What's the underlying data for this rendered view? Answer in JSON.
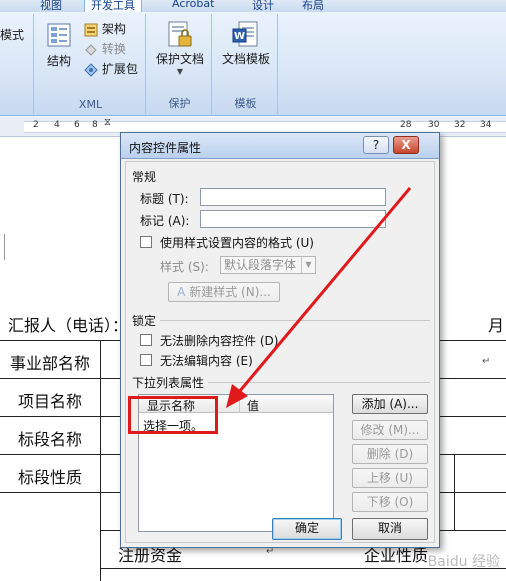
{
  "ribbon": {
    "tabs": [
      "视图",
      "开发工具",
      "Acrobat",
      "设计",
      "布局"
    ],
    "active_tab": "开发工具",
    "mode_label": "模式",
    "xml": {
      "structure": "结构",
      "schema": "架构",
      "transform": "转换",
      "expansion": "扩展包",
      "group": "XML"
    },
    "protect": {
      "protect_doc": "保护文档",
      "group": "保护"
    },
    "template": {
      "doc_template": "文档模板",
      "group": "模板"
    }
  },
  "ruler": [
    "2",
    "4",
    "6",
    "8",
    "28",
    "30",
    "32",
    "34"
  ],
  "document": {
    "reporter": "汇报人（电话）：",
    "month": "月",
    "rows": [
      "事业部名称",
      "项目名称",
      "标段名称",
      "标段性质"
    ],
    "bottom_left": "注册资金",
    "bottom_right": "企业性质"
  },
  "dialog": {
    "title": "内容控件属性",
    "help": "?",
    "close": "X",
    "general": {
      "section": "常规",
      "title_label": "标题 (T):",
      "title_value": "",
      "tag_label": "标记 (A):",
      "tag_value": "",
      "use_style": "使用样式设置内容的格式 (U)",
      "style_label": "样式 (S):",
      "style_value": "默认段落字体",
      "new_style": "新建样式 (N)..."
    },
    "lock": {
      "section": "锁定",
      "no_delete": "无法删除内容控件 (D)",
      "no_edit": "无法编辑内容 (E)"
    },
    "dropdown": {
      "section": "下拉列表属性",
      "col_display": "显示名称",
      "col_value": "值",
      "items": [
        "选择一项。"
      ],
      "add": "添加 (A)...",
      "modify": "修改 (M)...",
      "delete": "删除 (D)",
      "move_up": "上移 (U)",
      "move_down": "下移 (O)"
    },
    "ok": "确定",
    "cancel": "取消"
  },
  "watermark": "Baidu 经验",
  "colors": {
    "annotation_red": "#e0191b"
  }
}
